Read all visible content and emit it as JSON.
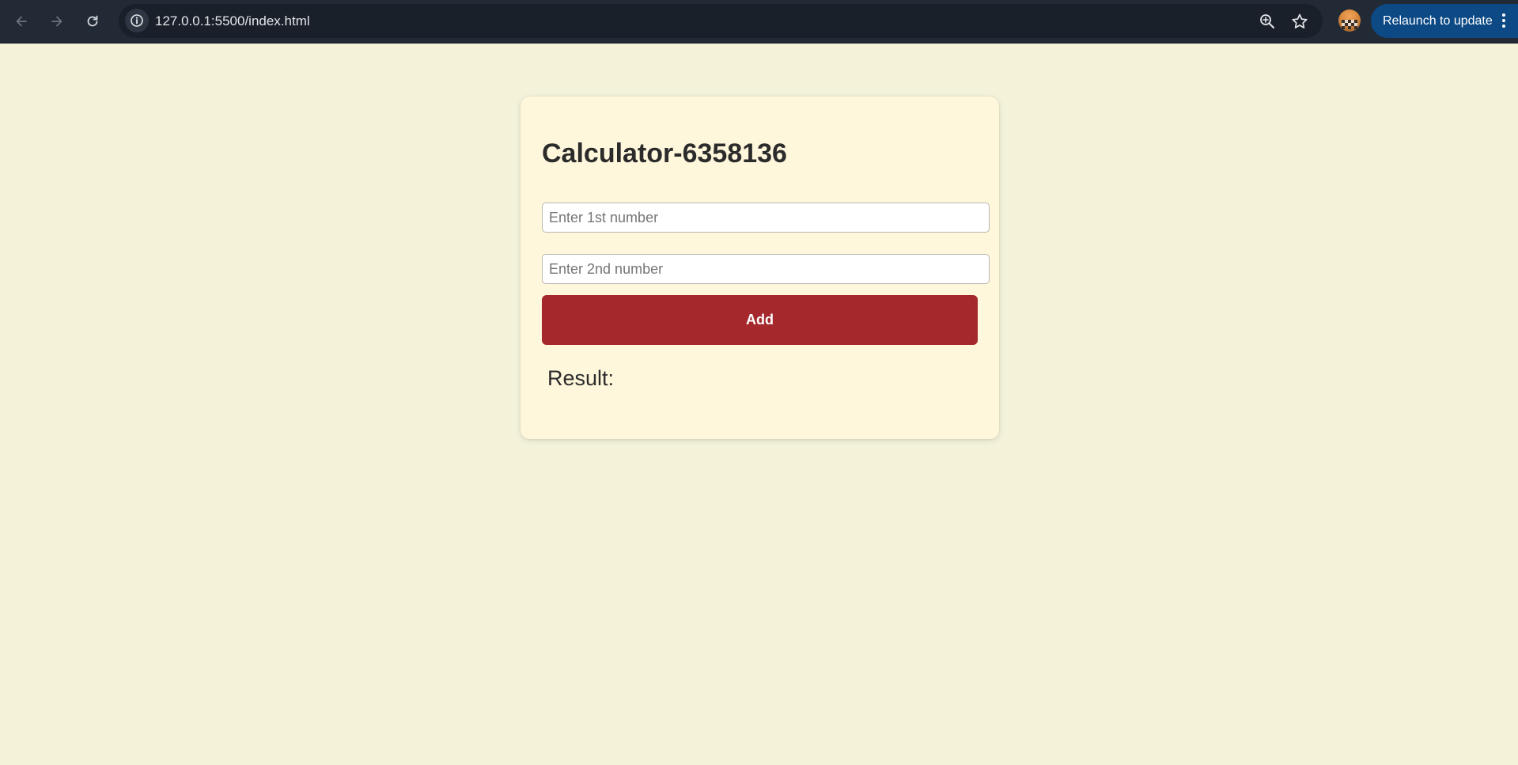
{
  "browser": {
    "url": "127.0.0.1:5500/index.html",
    "relaunch_label": "Relaunch to update",
    "icons": {
      "back": "arrow-left-icon",
      "forward": "arrow-right-icon",
      "reload": "reload-icon",
      "site_info": "info-icon",
      "zoom": "zoom-icon",
      "bookmark": "star-icon",
      "profile": "avatar",
      "menu": "kebab-menu-icon"
    },
    "colors": {
      "toolbar": "#222a35",
      "omnibox": "#1a2029",
      "relaunch": "#0d4a85"
    }
  },
  "calculator": {
    "title": "Calculator-6358136",
    "input1": {
      "placeholder": "Enter 1st number",
      "value": ""
    },
    "input2": {
      "placeholder": "Enter 2nd number",
      "value": ""
    },
    "add_label": "Add",
    "result_label": "Result:",
    "result_value": ""
  },
  "colors": {
    "page_background": "#f4f3da",
    "card_background": "#fff7dc",
    "button": "#a4282c",
    "text": "#2b2b2b"
  }
}
